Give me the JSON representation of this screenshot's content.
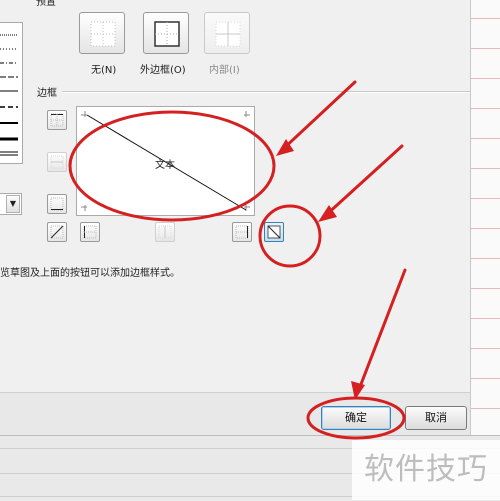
{
  "section_preset": {
    "title": "预置"
  },
  "presets": [
    {
      "label": "无(N)",
      "icon": "border-none-icon",
      "enabled": true
    },
    {
      "label": "外边框(O)",
      "icon": "border-outline-icon",
      "enabled": true
    },
    {
      "label": "内部(I)",
      "icon": "border-inside-icon",
      "enabled": false
    }
  ],
  "section_border": {
    "title": "边框"
  },
  "preview": {
    "text": "文本"
  },
  "hint": {
    "text": "览草图及上面的按钮可以添加边框样式。"
  },
  "buttons": {
    "ok": "确定",
    "cancel": "取消"
  },
  "watermark": {
    "text": "软件技巧"
  },
  "colors": {
    "annotation": "#d42020",
    "accent": "#3c7fb1"
  }
}
